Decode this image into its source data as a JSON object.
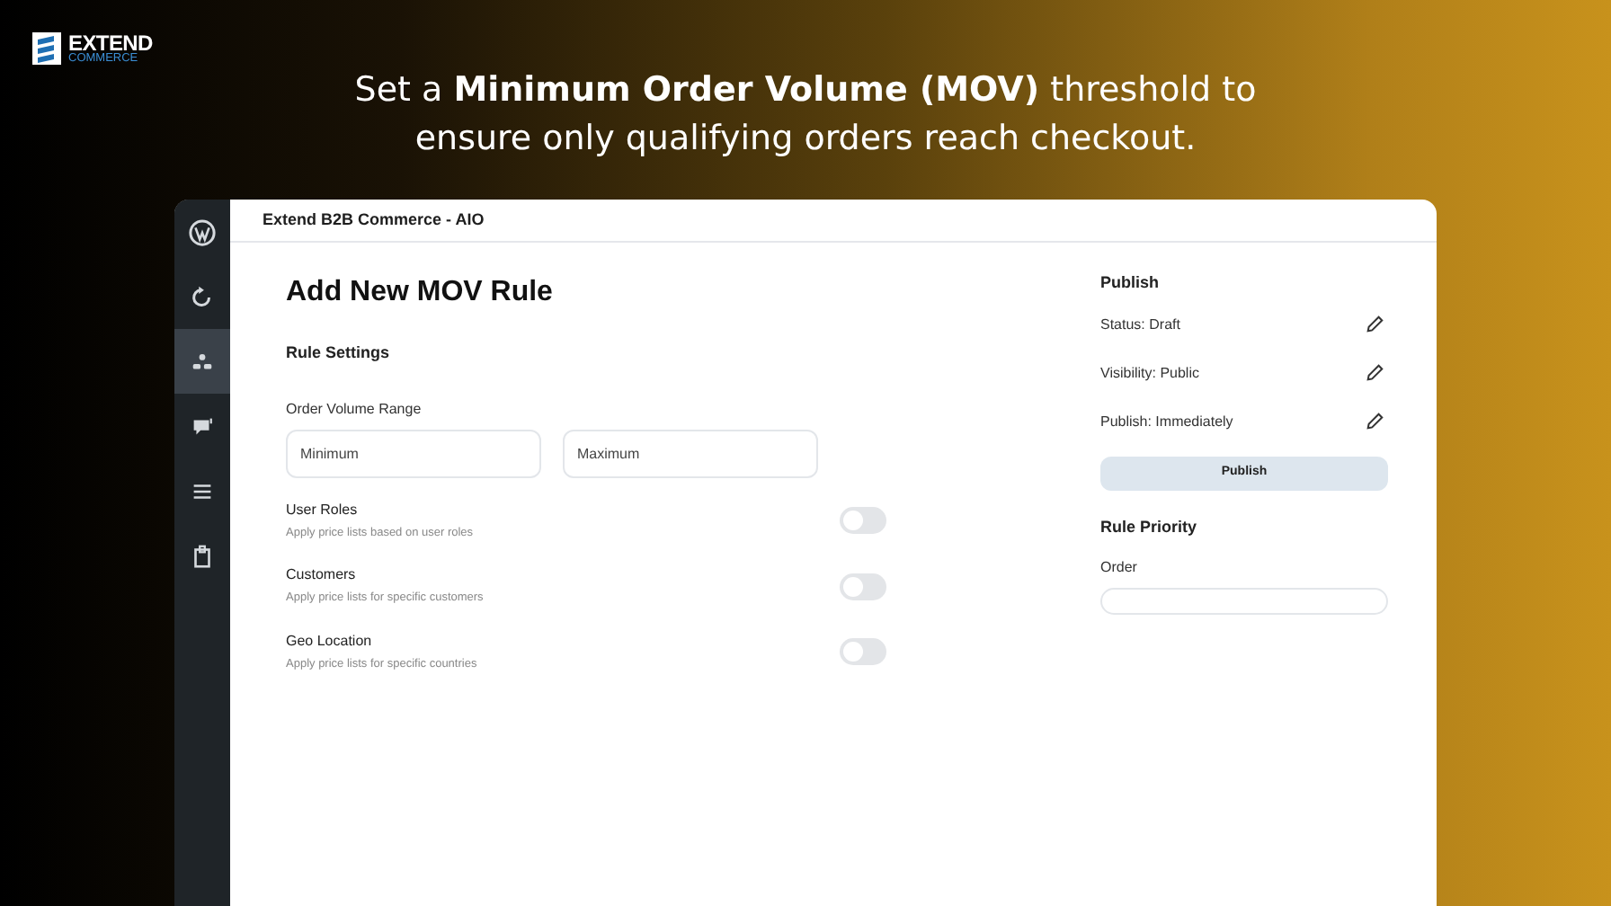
{
  "brand": {
    "name": "EXTEND",
    "tagline": "COMMERCE"
  },
  "headline": "Set a **Minimum Order Volume (MOV)** threshold to ensure only qualifying orders reach checkout.",
  "window": {
    "title": "Extend B2B Commerce - AIO"
  },
  "sidebar": {
    "items": [
      {
        "kind": "wordpress",
        "selected": false
      },
      {
        "kind": "refresh",
        "selected": false
      },
      {
        "kind": "users",
        "selected": true
      },
      {
        "kind": "comment",
        "selected": false
      },
      {
        "kind": "menu",
        "selected": false
      },
      {
        "kind": "clipboard",
        "selected": false
      }
    ]
  },
  "form": {
    "title": "Add New MOV Rule",
    "section": "Rule Settings",
    "range": {
      "label": "Order Volume Range",
      "fields": [
        {
          "placeholder": "Minimum"
        },
        {
          "placeholder": "Maximum"
        }
      ]
    },
    "options": [
      {
        "label": "User Roles",
        "description": "Apply price lists based on user roles",
        "on": false
      },
      {
        "label": "Customers",
        "description": "Apply price lists for specific customers",
        "on": false
      },
      {
        "label": "Geo Location",
        "description": "Apply price lists for specific countries",
        "on": false
      }
    ]
  },
  "publish": {
    "title": "Publish",
    "rows": [
      {
        "label": "Status: Draft"
      },
      {
        "label": "Visibility: Public"
      },
      {
        "label": "Publish: Immediately"
      }
    ],
    "button": "Publish"
  },
  "priority": {
    "title": "Rule Priority",
    "label": "Order"
  }
}
